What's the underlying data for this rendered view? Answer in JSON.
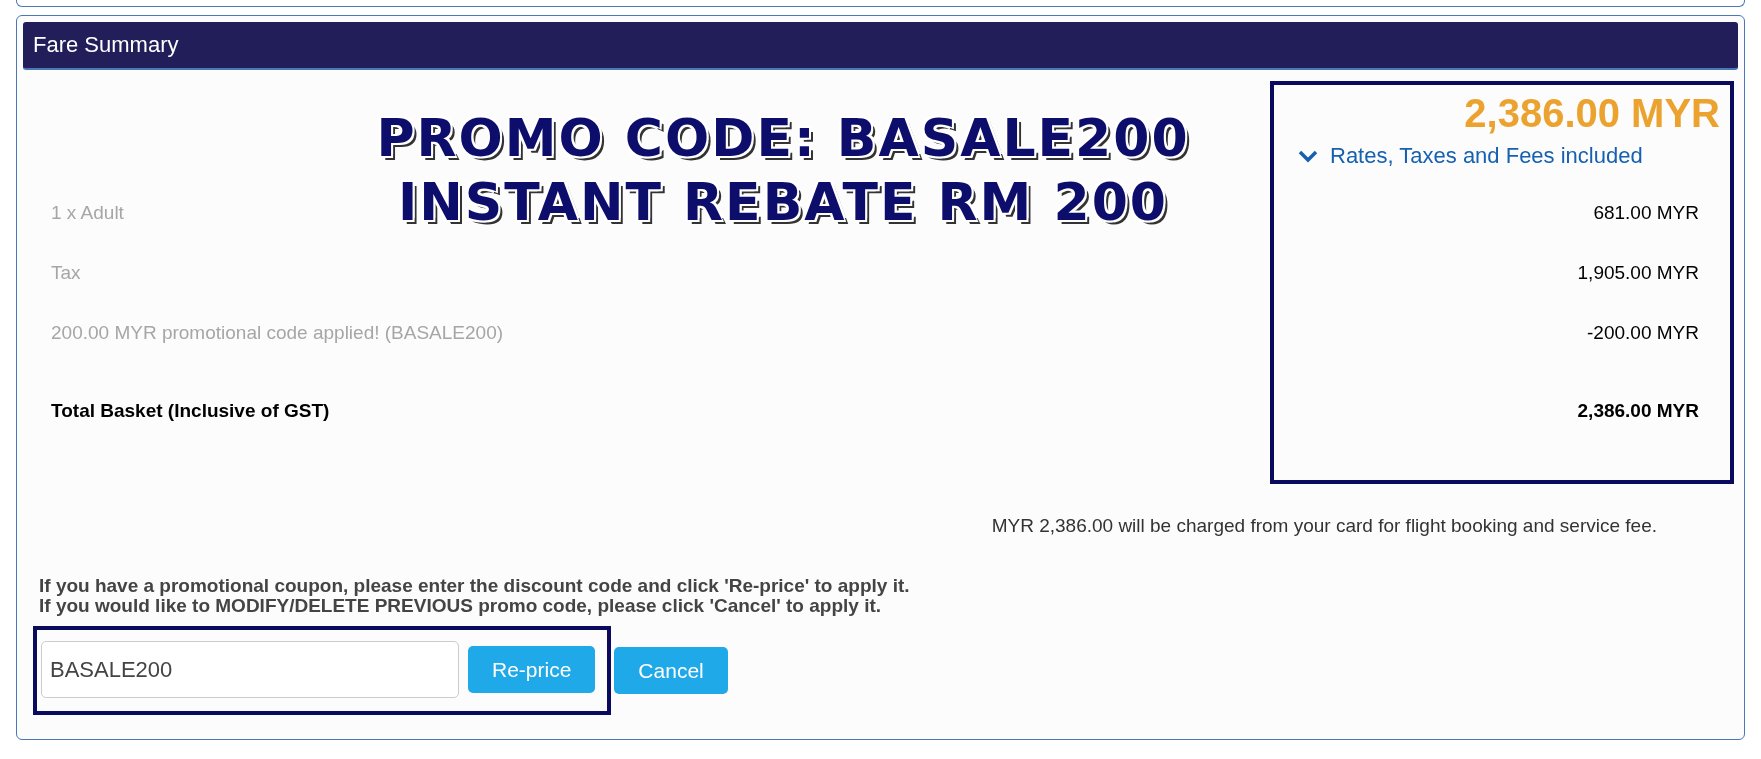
{
  "panel": {
    "title": "Fare Summary"
  },
  "overlay": {
    "lines": [
      "PROMO CODE: BASALE200",
      "INSTANT REBATE RM 200"
    ]
  },
  "total_price": "2,386.00 MYR",
  "breakdown_toggle": {
    "label": "Rates, Taxes and Fees included",
    "expanded": true
  },
  "lines": [
    {
      "label": "1 x Adult",
      "amount": "681.00 MYR",
      "kind": "item"
    },
    {
      "label": "Tax",
      "amount": "1,905.00 MYR",
      "kind": "item"
    },
    {
      "label": "200.00 MYR promotional code applied! (BASALE200)",
      "amount": "-200.00 MYR",
      "kind": "item"
    },
    {
      "label": "Total Basket (Inclusive of GST)",
      "amount": "2,386.00 MYR",
      "kind": "total"
    }
  ],
  "charge_note": "MYR 2,386.00 will be charged from your card for flight booking and service fee.",
  "instructions": [
    "If you have a promotional coupon, please enter the discount code and click 'Re-price' to apply it.",
    "If you would like to MODIFY/DELETE PREVIOUS promo code, please click 'Cancel' to apply it."
  ],
  "promo": {
    "value": "BASALE200",
    "buttons": [
      "Re-price",
      "Cancel"
    ]
  }
}
